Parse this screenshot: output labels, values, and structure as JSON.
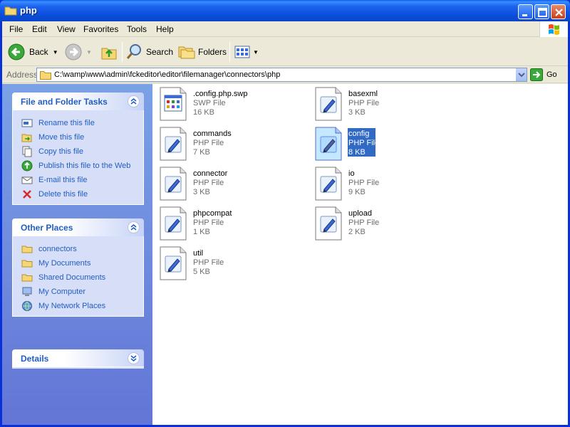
{
  "window": {
    "title": "php"
  },
  "menu": [
    "File",
    "Edit",
    "View",
    "Favorites",
    "Tools",
    "Help"
  ],
  "toolbar": {
    "back": "Back",
    "search": "Search",
    "folders": "Folders"
  },
  "address": {
    "label": "Address",
    "path": "C:\\wamp\\www\\admin\\fckeditor\\editor\\filemanager\\connectors\\php",
    "go": "Go"
  },
  "panels": {
    "file_tasks": {
      "title": "File and Folder Tasks",
      "items": [
        {
          "label": "Rename this file",
          "icon": "rename-icon"
        },
        {
          "label": "Move this file",
          "icon": "move-icon"
        },
        {
          "label": "Copy this file",
          "icon": "copy-icon"
        },
        {
          "label": "Publish this file to the Web",
          "icon": "publish-icon"
        },
        {
          "label": "E-mail this file",
          "icon": "email-icon"
        },
        {
          "label": "Delete this file",
          "icon": "delete-icon"
        }
      ]
    },
    "other_places": {
      "title": "Other Places",
      "items": [
        {
          "label": "connectors",
          "icon": "folder-icon"
        },
        {
          "label": "My Documents",
          "icon": "folder-icon"
        },
        {
          "label": "Shared Documents",
          "icon": "folder-icon"
        },
        {
          "label": "My Computer",
          "icon": "computer-icon"
        },
        {
          "label": "My Network Places",
          "icon": "network-icon"
        }
      ]
    },
    "details": {
      "title": "Details"
    }
  },
  "files": [
    {
      "name": ".config.php.swp",
      "type": "SWP File",
      "size": "16 KB",
      "icon": "swp-file-icon"
    },
    {
      "name": "basexml",
      "type": "PHP File",
      "size": "3 KB",
      "icon": "php-file-icon"
    },
    {
      "name": "commands",
      "type": "PHP File",
      "size": "7 KB",
      "icon": "php-file-icon"
    },
    {
      "name": "config",
      "type": "PHP File",
      "size": "8 KB",
      "icon": "php-file-icon",
      "selected": true
    },
    {
      "name": "connector",
      "type": "PHP File",
      "size": "3 KB",
      "icon": "php-file-icon"
    },
    {
      "name": "io",
      "type": "PHP File",
      "size": "9 KB",
      "icon": "php-file-icon"
    },
    {
      "name": "phpcompat",
      "type": "PHP File",
      "size": "1 KB",
      "icon": "php-file-icon"
    },
    {
      "name": "upload",
      "type": "PHP File",
      "size": "2 KB",
      "icon": "php-file-icon"
    },
    {
      "name": "util",
      "type": "PHP File",
      "size": "5 KB",
      "icon": "php-file-icon"
    }
  ]
}
